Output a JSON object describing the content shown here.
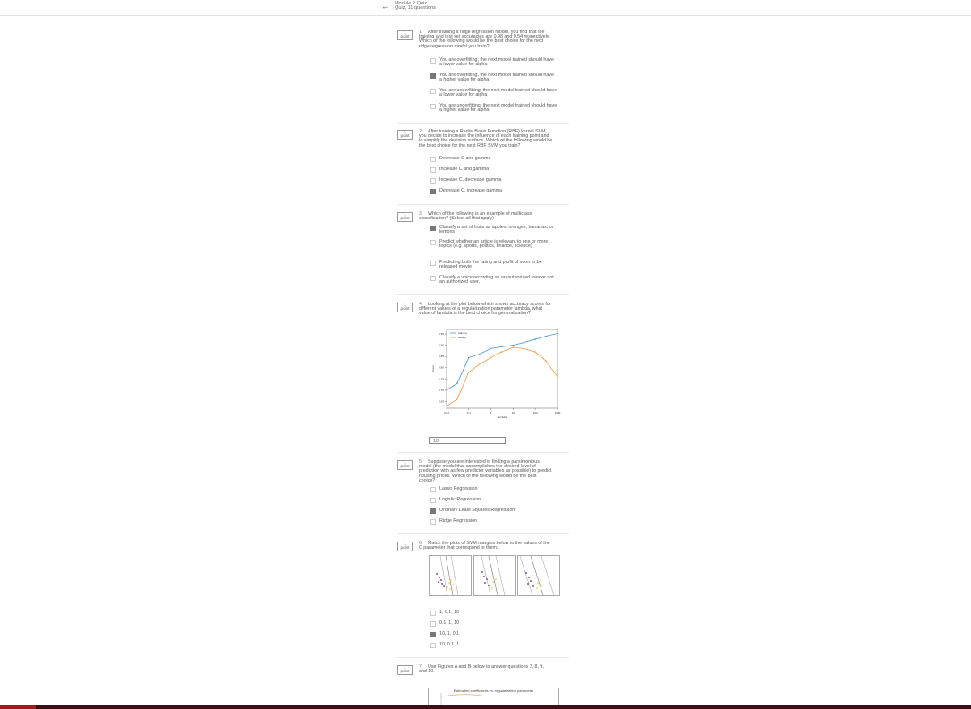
{
  "header": {
    "back_icon": "arrow-left-icon",
    "title": "Module 2 Quiz",
    "subtitle": "Quiz, 11 questions"
  },
  "questions": [
    {
      "num": "1.",
      "points": [
        "1",
        "point"
      ],
      "text": "After training a ridge regression model, you find that the training and test set accuracies are 0.98 and 0.54 respectively. Which of the following would be the best choice for the next ridge regression model you train?",
      "options": [
        "You are overfitting, the next model trained should have a lower value for alpha",
        "You are overfitting, the next model trained should have a higher value for alpha",
        "You are underfitting, the next model trained should have a lower value for alpha",
        "You are underfitting, the next model trained should have a higher value for alpha"
      ],
      "selected": 1
    },
    {
      "num": "2.",
      "points": [
        "1",
        "point"
      ],
      "text": "After training a Radial Basis Function (RBF) kernel SVM, you decide to increase the influence of each training point and to simplify the decision surface. Which of the following would be the best choice for the next RBF SVM you train?",
      "options": [
        "Decrease C and gamma",
        "Increase C and gamma",
        "Increase C, decrease gamma",
        "Decrease C, increase gamma"
      ],
      "selected": 3
    },
    {
      "num": "3.",
      "points": [
        "1",
        "point"
      ],
      "text": "Which of the following is an example of multiclass classification? (Select all that apply)",
      "options": [
        "Classify a set of fruits as apples, oranges, bananas, or lemons",
        "Predict whether an article is relevant to one or more topics (e.g. sports, politics, finance, science)",
        "Predicting both the rating and profit of soon to be released movie",
        "Classify a voice recording as an authorized user or not an authorized user."
      ],
      "selected": 0
    },
    {
      "num": "4.",
      "points": [
        "1",
        "point"
      ],
      "text": "Looking at the plot below which shows accuracy scores for different values of a regularization parameter lambda, what value of lambda is the best choice for generalization?",
      "answer": "10"
    },
    {
      "num": "5.",
      "points": [
        "1",
        "point"
      ],
      "text": "Suppose you are interested in finding a parsimonious model (the model that accomplishes the desired level of prediction with as few predictor variables as possible) to predict housing prices. Which of the following would be the best choice?",
      "options": [
        "Lasso Regression",
        "Logistic Regression",
        "Ordinary Least Squares Regression",
        "Ridge Regression"
      ],
      "selected": 2
    },
    {
      "num": "6.",
      "points": [
        "1",
        "point"
      ],
      "text": "Match the plots of SVM margins below to the values of the C parameter that correspond to them.",
      "options": [
        "1, 0.1, 10",
        "0.1, 1, 10",
        "10, 1, 0.1",
        "10, 0.1, 1"
      ],
      "selected": 2
    },
    {
      "num": "7.",
      "points": [
        "1",
        "point"
      ],
      "text": "Use Figures A and B below to answer questions 7, 8, 9, and 10.",
      "figure_title": "Estimated coefficients vs. regularization parameter"
    }
  ],
  "chart_data": {
    "type": "line",
    "categories": [
      "0.01",
      "0.1",
      "1",
      "10",
      "100",
      "1000"
    ],
    "x": [
      0.01,
      0.03,
      0.1,
      0.3,
      1,
      3,
      10,
      30,
      100,
      300,
      1000
    ],
    "series": [
      {
        "name": "training",
        "color": "#4e97c9",
        "values": [
          0.7,
          0.73,
          0.845,
          0.86,
          0.885,
          0.893,
          0.9,
          0.912,
          0.926,
          0.94,
          0.952
        ]
      },
      {
        "name": "testing",
        "color": "#f2994a",
        "values": [
          0.63,
          0.66,
          0.78,
          0.815,
          0.845,
          0.87,
          0.89,
          0.885,
          0.87,
          0.83,
          0.76
        ]
      }
    ],
    "yticks": [
      "0.65",
      "0.70",
      "0.75",
      "0.80",
      "0.85",
      "0.90",
      "0.95"
    ],
    "ylim": [
      0.62,
      0.97
    ],
    "xlabel": "lambda",
    "ylabel": "Score",
    "legend": "top-left",
    "grid": false
  },
  "colors": {
    "selected": "#777777",
    "footer": "#3c0f14",
    "footer_accent": "#9a1b22"
  }
}
